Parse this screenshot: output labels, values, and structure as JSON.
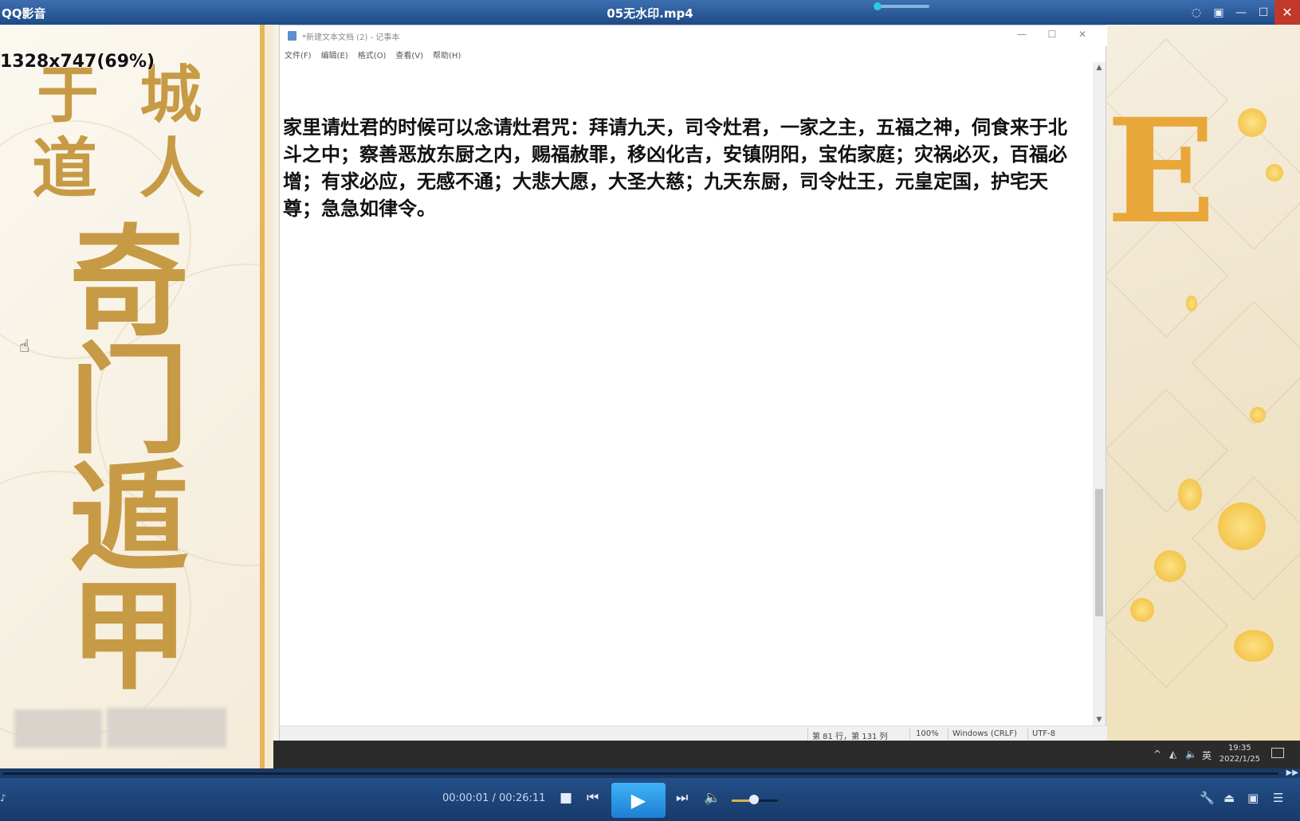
{
  "window": {
    "app_name": "QQ影音",
    "file_title": "05无水印.mp4"
  },
  "video": {
    "resolution_label": "1328x747(69%)",
    "callig_line1": "于 城",
    "callig_line2": "道 人",
    "callig_main": "奇门遁甲"
  },
  "notepad": {
    "title": "*新建文本文档 (2) - 记事本",
    "menu": [
      "文件(F)",
      "编辑(E)",
      "格式(O)",
      "查看(V)",
      "帮助(H)"
    ],
    "content": "家里请灶君的时候可以念请灶君咒：拜请九天，司令灶君，一家之主，五福之神，伺食来于北斗之中；察善恶放东厨之内，赐福赦罪，移凶化吉，安镇阴阳，宝佑家庭；灾祸必灭，百福必增；有求必应，无感不通；大悲大愿，大圣大慈；九天东厨，司令灶王，元皇定国，护宅天尊；急急如律令。",
    "status": {
      "position": "第 81 行，第 131 列",
      "zoom": "100%",
      "line_ending": "Windows (CRLF)",
      "encoding": "UTF-8"
    }
  },
  "taskbar": {
    "ime": "英",
    "time": "19:35",
    "date": "2022/1/25"
  },
  "player": {
    "time_display": "00:00:01 / 00:26:11",
    "progress": 0.0006,
    "volume": 0.48
  },
  "colors": {
    "titlebar": "#2f5fa0",
    "gold": "#c79a45",
    "play_button": "#2a97e6"
  }
}
